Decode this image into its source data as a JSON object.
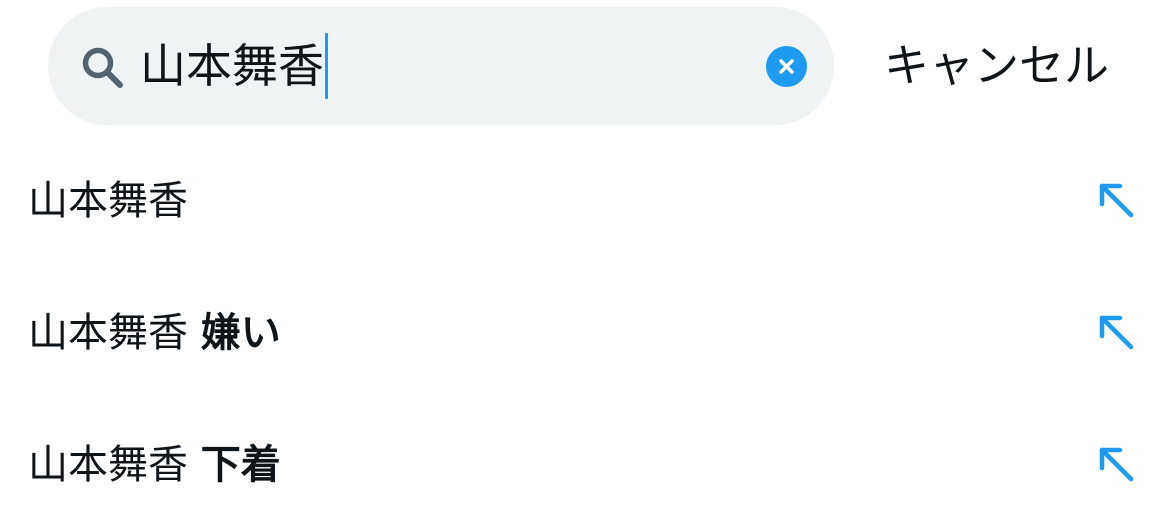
{
  "search": {
    "query": "山本舞香",
    "icon": "search-icon",
    "clear_icon": "close-icon",
    "cancel_label": "キャンセル",
    "accent_color": "#1d9bf0",
    "field_background": "#eff3f4"
  },
  "suggestions": [
    {
      "base": "山本舞香",
      "extra": ""
    },
    {
      "base": "山本舞香",
      "extra": "嫌い"
    },
    {
      "base": "山本舞香",
      "extra": "下着"
    }
  ],
  "suggestion_icon": "arrow-up-left-icon"
}
